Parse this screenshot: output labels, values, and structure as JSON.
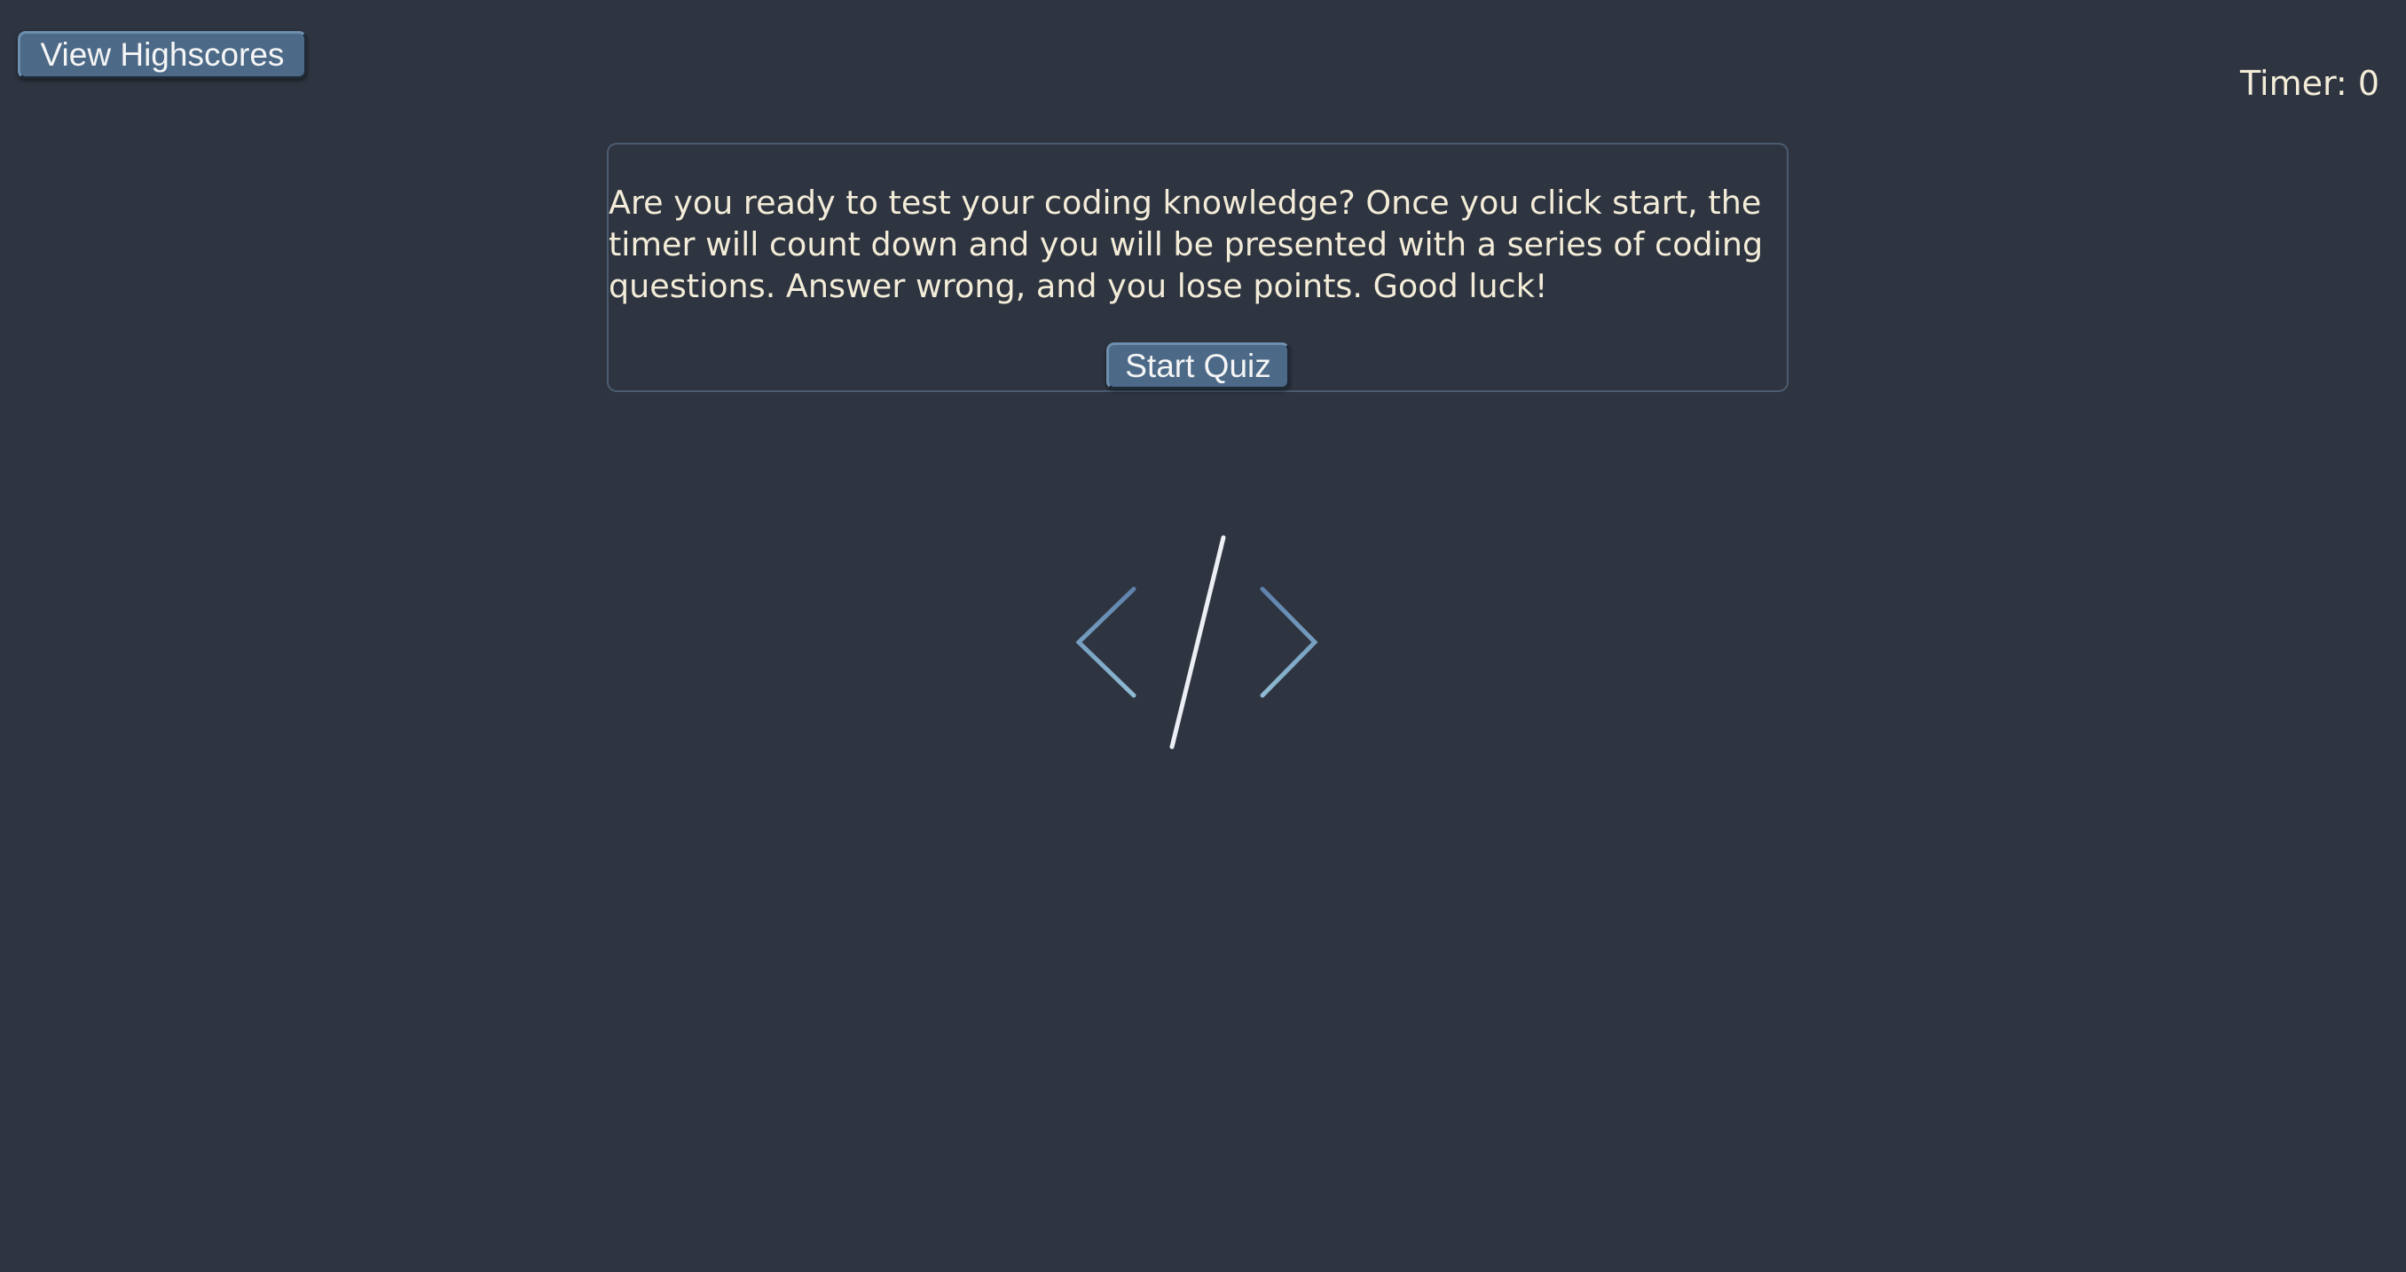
{
  "header": {
    "highscores_label": "View Highscores",
    "timer_text": "Timer: 0"
  },
  "intro": {
    "text": "Are you ready to test your coding knowledge? Once you click start, the timer will count down and you will be presented with a series of coding questions. Answer wrong, and you lose points. Good luck!",
    "start_label": "Start Quiz"
  },
  "logo": {
    "icon": "code-brackets-icon",
    "colors": {
      "bracket_top": "#5e81ac",
      "bracket_bottom": "#88c0d0",
      "slash": "#eceff4"
    }
  },
  "theme": {
    "background": "#2e3440",
    "button": "#4c6a88",
    "text": "#f3ecd8",
    "card_border": "#4b5c70"
  }
}
